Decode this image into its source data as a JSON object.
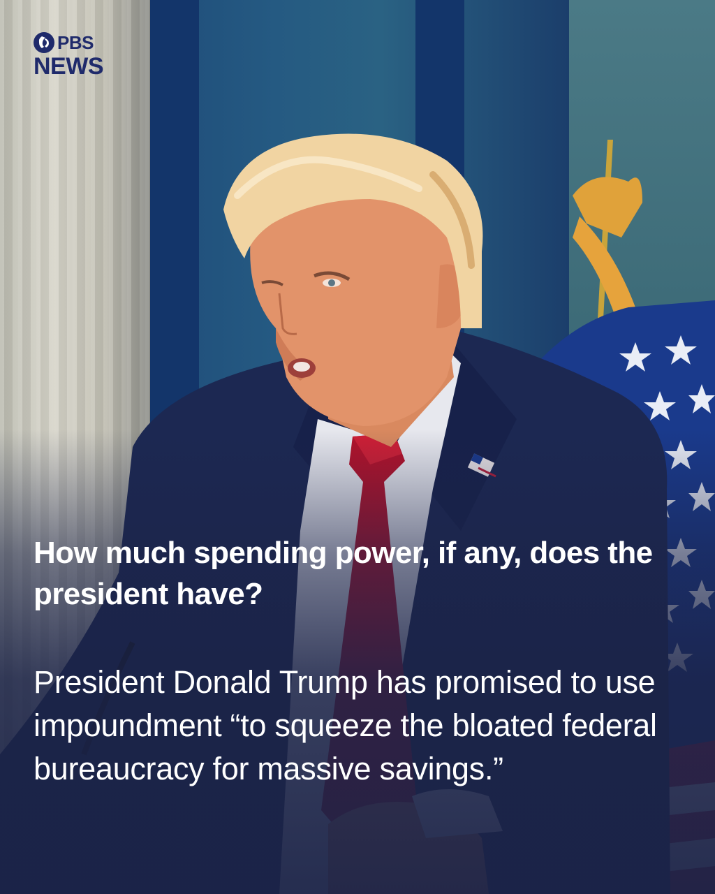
{
  "brand": {
    "logo_top": "PBS",
    "logo_bottom": "NEWS"
  },
  "headline": "How much spending power, if any, does the president have?",
  "body": "President Donald Trump has promised to use impoundment “to squeeze the bloated federal bureaucracy for massive savings.”",
  "colors": {
    "text": "#ffffff",
    "logo": "#1f2a6b",
    "overlay": "#1b2347",
    "tie": "#b3122a",
    "suit": "#1c2852"
  }
}
